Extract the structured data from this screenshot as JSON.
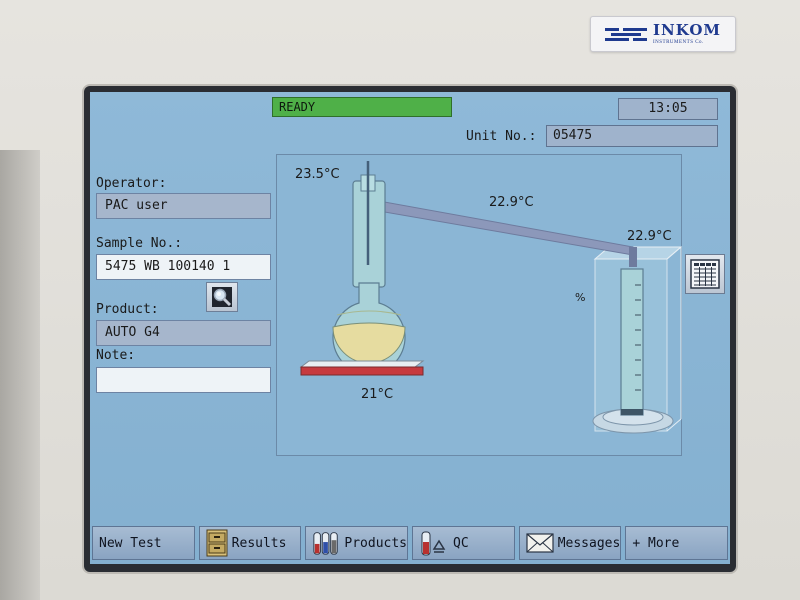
{
  "brand": {
    "name": "INKOM",
    "subtitle": "INSTRUMENTS Co.",
    "color": "#1f3a8f"
  },
  "status": {
    "text": "READY",
    "color": "#4fb048"
  },
  "clock": "13:05",
  "unit": {
    "label": "Unit No.:",
    "value": "05475"
  },
  "fields": {
    "operator": {
      "label": "Operator:",
      "value": "PAC user"
    },
    "sample": {
      "label": "Sample No.:",
      "value": "5475 WB 100140 1"
    },
    "product": {
      "label": "Product:",
      "value": "AUTO G4"
    },
    "note": {
      "label": "Note:",
      "value": ""
    }
  },
  "apparatus": {
    "temps": {
      "vapor": "23.5°C",
      "condenser": "22.9°C",
      "receiver": "22.9°C",
      "heater": "21°C"
    },
    "percent_symbol": "%"
  },
  "icons": {
    "lookup": "magnifier-icon",
    "side": "table-grid-icon",
    "results": "file-cabinet-icon",
    "products": "sample-tubes-icon",
    "qc": "qc-tube-icon",
    "messages": "envelope-icon"
  },
  "buttons": {
    "new_test": "New Test",
    "results": "Results",
    "products": "Products",
    "qc": "QC",
    "messages": "Messages",
    "more": "+ More"
  }
}
